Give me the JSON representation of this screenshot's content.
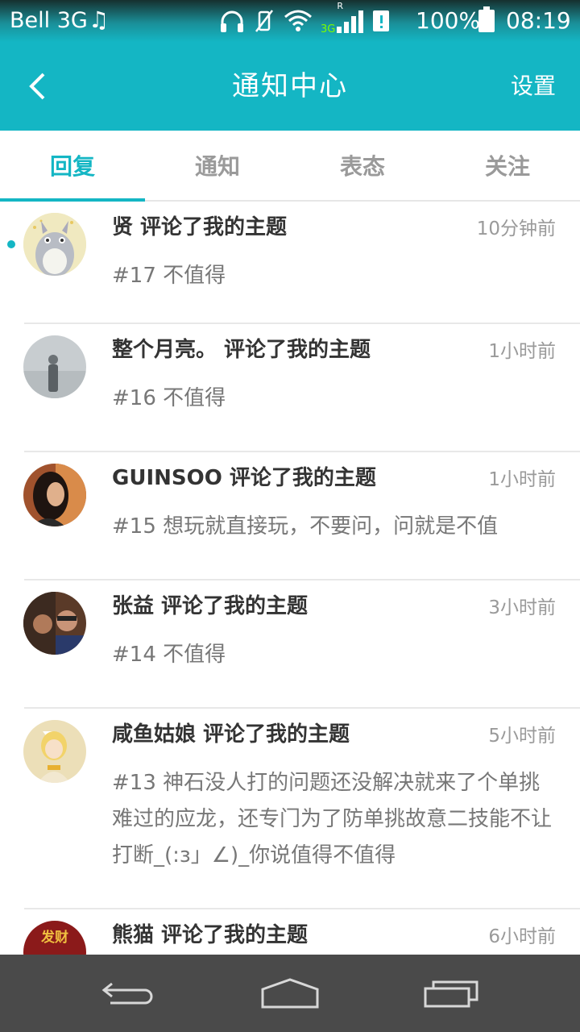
{
  "status_bar": {
    "carrier": "Bell 3G",
    "network_type": "3G",
    "roaming": "R",
    "battery": "100%",
    "time": "08:19"
  },
  "header": {
    "title": "通知中心",
    "settings_label": "设置"
  },
  "tabs": [
    {
      "label": "回复",
      "active": true
    },
    {
      "label": "通知",
      "active": false
    },
    {
      "label": "表态",
      "active": false
    },
    {
      "label": "关注",
      "active": false
    }
  ],
  "notifications": [
    {
      "name": "贤 评论了我的主题",
      "time": "10分钟前",
      "body": "#17 不值得",
      "unread": true,
      "avatar": "totoro-avatar"
    },
    {
      "name": "整个月亮。 评论了我的主题",
      "time": "1小时前",
      "body": "#16 不值得",
      "unread": false,
      "avatar": "foggy-figure-avatar"
    },
    {
      "name": "GUINSOO 评论了我的主题",
      "time": "1小时前",
      "body": "#15 想玩就直接玩，不要问，问就是不值",
      "unread": false,
      "avatar": "woman-portrait-avatar"
    },
    {
      "name": "张益 评论了我的主题",
      "time": "3小时前",
      "body": "#14 不值得",
      "unread": false,
      "avatar": "photo-avatar"
    },
    {
      "name": "咸鱼姑娘 评论了我的主题",
      "time": "5小时前",
      "body": "#13 神石没人打的问题还没解决就来了个单挑难过的应龙，还专门为了防单挑故意二技能不让打断_(:з」∠)_你说值得不值得",
      "unread": false,
      "avatar": "anime-girl-avatar"
    },
    {
      "name": "熊猫 评论了我的主题",
      "time": "6小时前",
      "body": "",
      "unread": false,
      "avatar": "facai-avatar",
      "avatar_text": "发财"
    }
  ],
  "nav": [
    "back-nav-icon",
    "home-nav-icon",
    "recents-nav-icon"
  ],
  "colors": {
    "accent": "#14b6c4",
    "nav_bar": "#4a4a4a",
    "unread_dot": "#14b6c4"
  }
}
